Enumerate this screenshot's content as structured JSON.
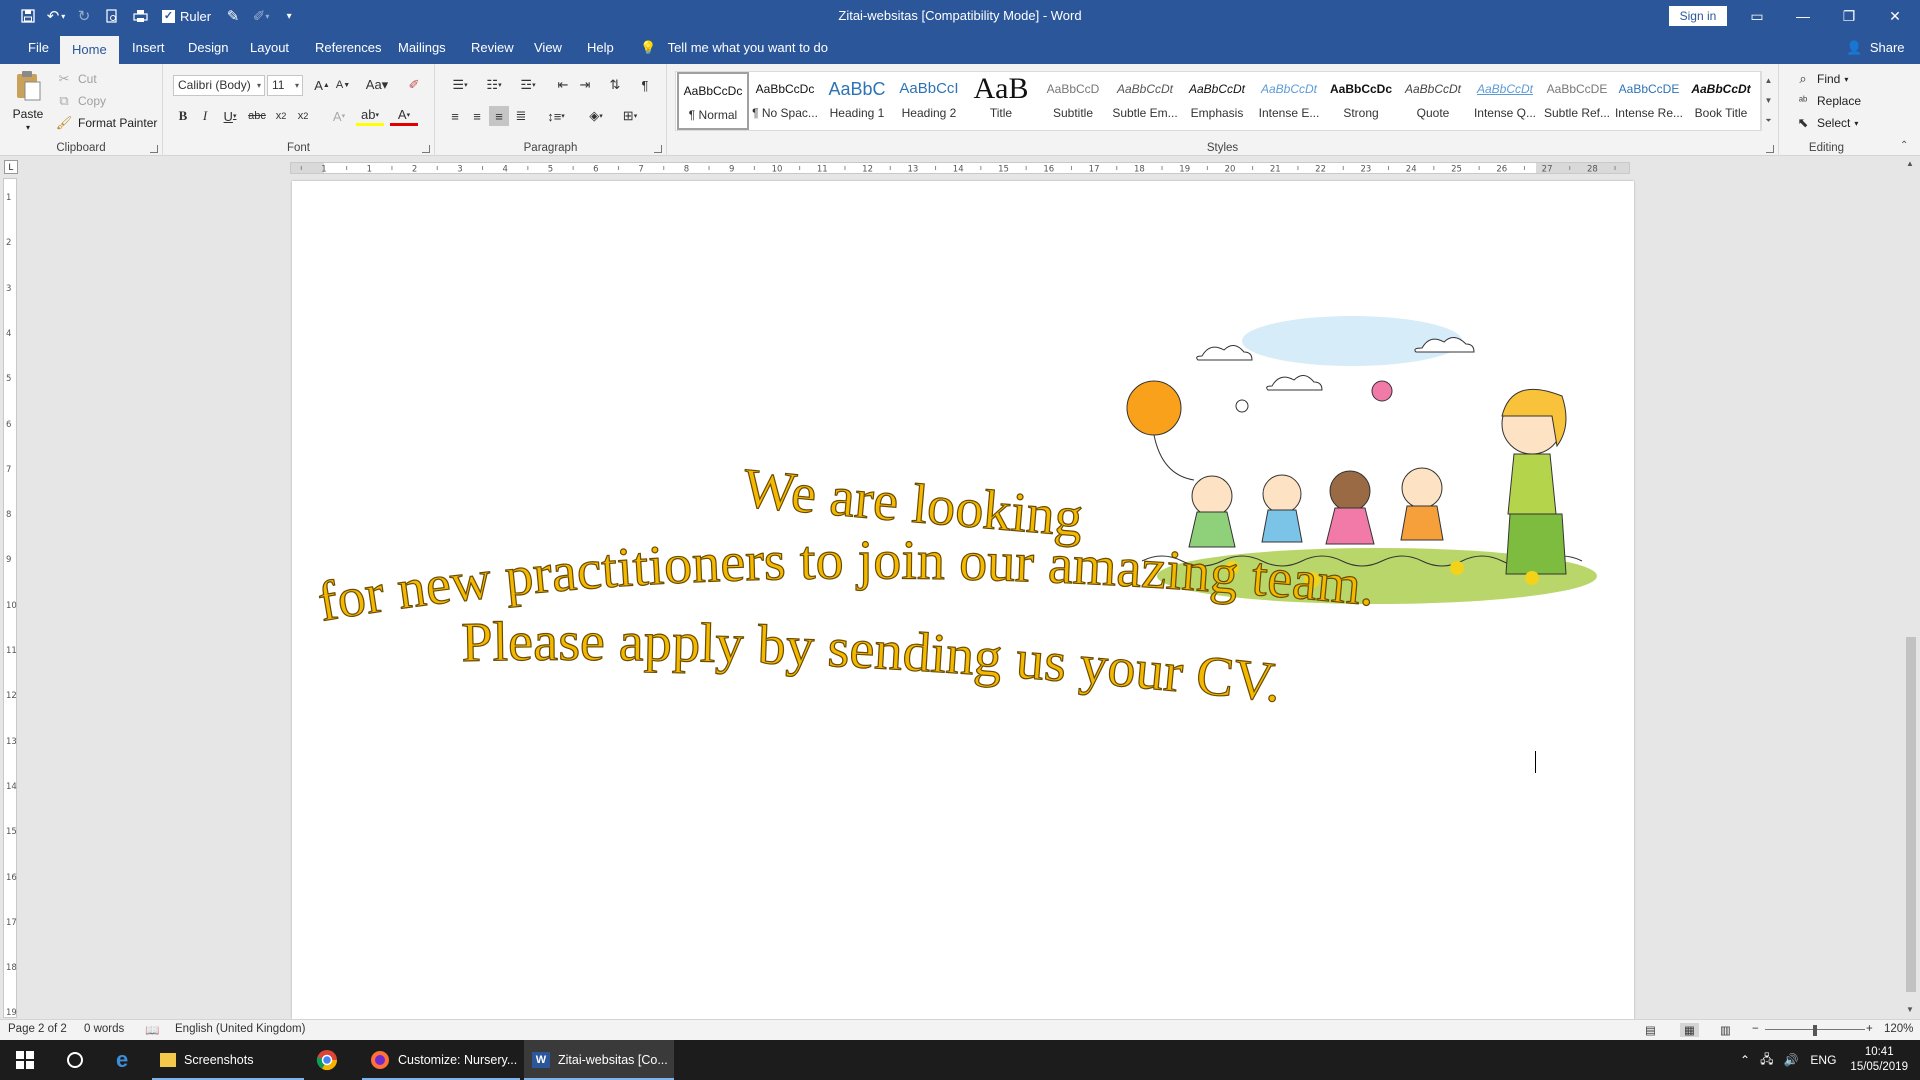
{
  "window": {
    "title": "Zitai-websitas [Compatibility Mode]  -  Word",
    "sign_in": "Sign in",
    "ruler_label": "Ruler",
    "ruler_checked": "✓"
  },
  "tabs": [
    "File",
    "Home",
    "Insert",
    "Design",
    "Layout",
    "References",
    "Mailings",
    "Review",
    "View",
    "Help"
  ],
  "active_tab": "Home",
  "tell_me": "Tell me what you want to do",
  "share": "Share",
  "clipboard": {
    "paste": "Paste",
    "cut": "Cut",
    "copy": "Copy",
    "format_painter": "Format Painter",
    "label": "Clipboard"
  },
  "font": {
    "family": "Calibri (Body)",
    "size": "11",
    "label": "Font"
  },
  "paragraph": {
    "label": "Paragraph"
  },
  "styles": {
    "label": "Styles",
    "items": [
      {
        "sample": "AaBbCcDc",
        "name": "¶ Normal"
      },
      {
        "sample": "AaBbCcDc",
        "name": "¶ No Spac..."
      },
      {
        "sample": "AaBbC",
        "name": "Heading 1"
      },
      {
        "sample": "AaBbCcI",
        "name": "Heading 2"
      },
      {
        "sample": "AaB",
        "name": "Title"
      },
      {
        "sample": "AaBbCcD",
        "name": "Subtitle"
      },
      {
        "sample": "AaBbCcDt",
        "name": "Subtle Em..."
      },
      {
        "sample": "AaBbCcDt",
        "name": "Emphasis"
      },
      {
        "sample": "AaBbCcDt",
        "name": "Intense E..."
      },
      {
        "sample": "AaBbCcDc",
        "name": "Strong"
      },
      {
        "sample": "AaBbCcDt",
        "name": "Quote"
      },
      {
        "sample": "AaBbCcDt",
        "name": "Intense Q..."
      },
      {
        "sample": "AaBbCcDE",
        "name": "Subtle Ref..."
      },
      {
        "sample": "AaBbCcDE",
        "name": "Intense Re..."
      },
      {
        "sample": "AaBbCcDt",
        "name": "Book Title"
      }
    ]
  },
  "editing": {
    "find": "Find",
    "replace": "Replace",
    "select": "Select",
    "label": "Editing"
  },
  "ruler_numbers": [
    "2",
    "1",
    "1",
    "2",
    "3",
    "4",
    "5",
    "6",
    "7",
    "8",
    "9",
    "10",
    "11",
    "12",
    "13",
    "14",
    "15",
    "16",
    "17",
    "18",
    "19",
    "20",
    "21",
    "22",
    "23",
    "24",
    "25",
    "26",
    "27",
    "28"
  ],
  "vruler_numbers": [
    "1",
    "2",
    "3",
    "4",
    "5",
    "6",
    "7",
    "8",
    "9",
    "10",
    "11",
    "12",
    "13",
    "14",
    "15",
    "16",
    "17",
    "18",
    "19"
  ],
  "document": {
    "line1": "We are looking",
    "line2": "for new practitioners to join our amazing team.",
    "line3": "Please apply by sending us your CV.",
    "text_color": "#f3b800"
  },
  "status": {
    "page": "Page 2 of 2",
    "words": "0 words",
    "language": "English (United Kingdom)",
    "zoom": "120%"
  },
  "taskbar": {
    "apps": [
      {
        "label": "Screenshots"
      },
      {
        "label": ""
      },
      {
        "label": "Customize: Nursery..."
      },
      {
        "label": "Zitai-websitas [Co..."
      }
    ],
    "lang": "ENG",
    "time": "10:41",
    "date": "15/05/2019"
  },
  "colors": {
    "accent": "#2b579a",
    "ribbon_bg": "#f3f3f3",
    "taskbar_bg": "#1c1c1c"
  }
}
